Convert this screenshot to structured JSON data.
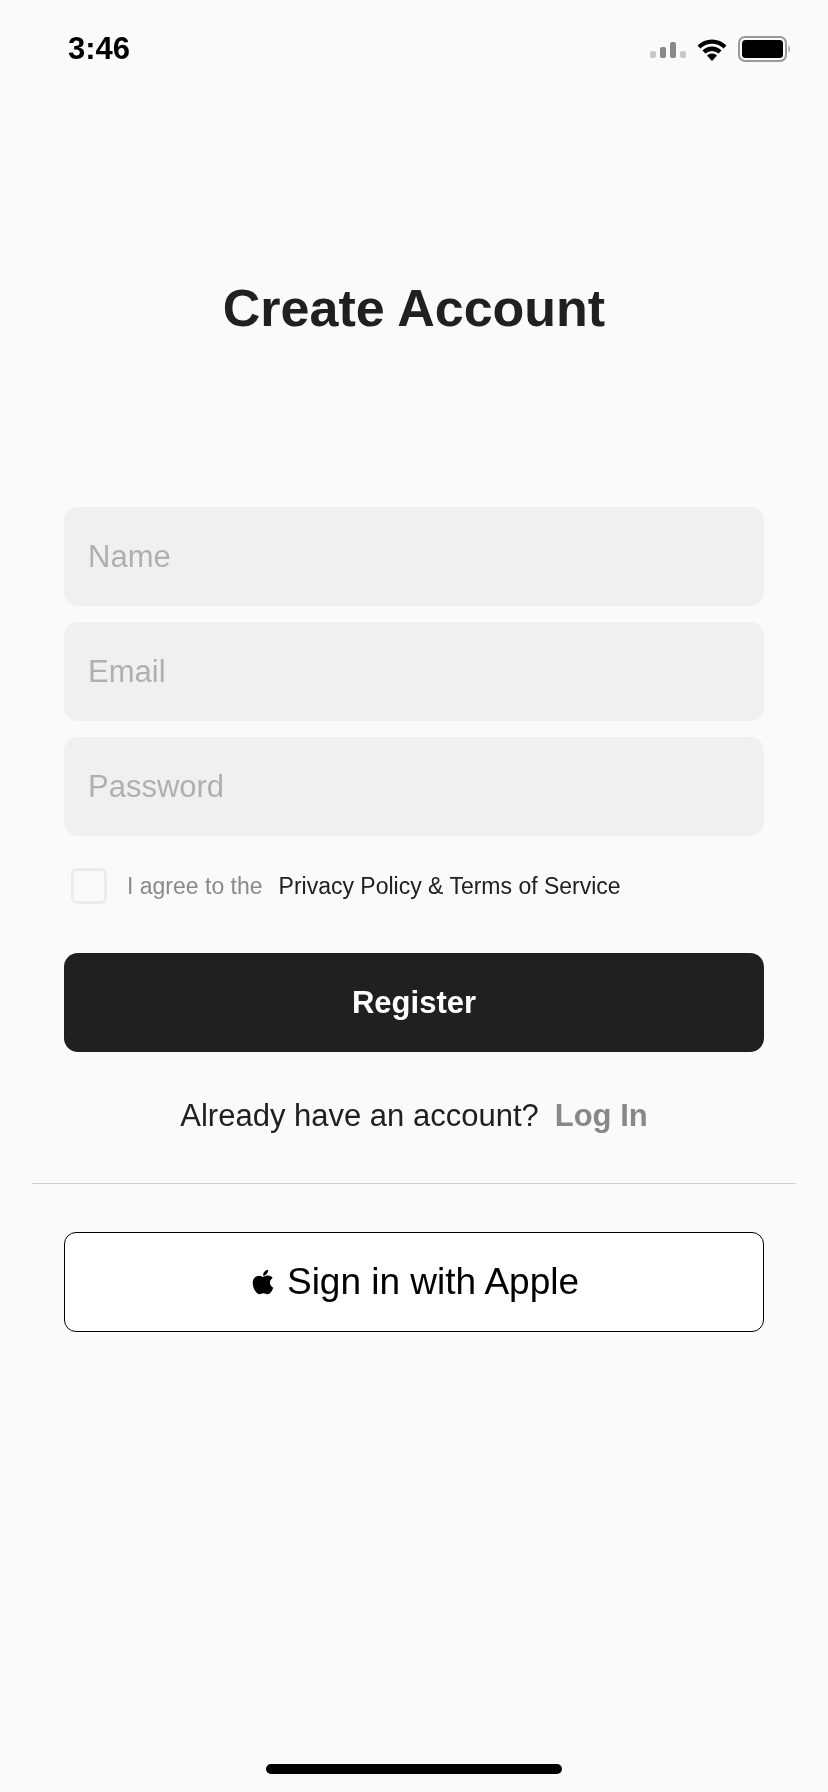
{
  "status_bar": {
    "time": "3:46"
  },
  "title": "Create Account",
  "fields": [
    {
      "placeholder": "Name"
    },
    {
      "placeholder": "Email"
    },
    {
      "placeholder": "Password"
    }
  ],
  "agreement": {
    "checked": false,
    "prefix": "I agree to the",
    "link": "Privacy Policy & Terms of Service"
  },
  "register_button": "Register",
  "login_prompt": {
    "text": "Already have an account?",
    "link": "Log In"
  },
  "apple_button": "Sign in with Apple"
}
